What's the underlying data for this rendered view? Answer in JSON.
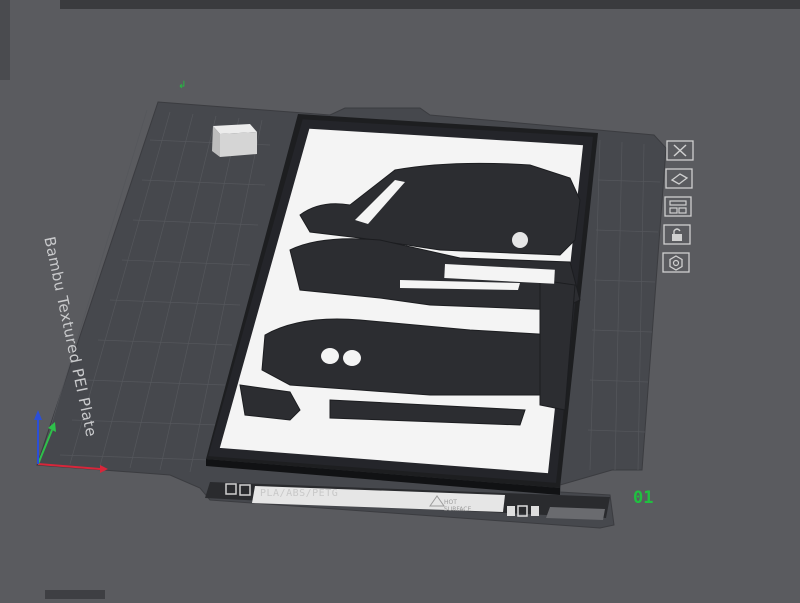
{
  "plate": {
    "name": "Bambu Textured PEI Plate",
    "filament": "PLA/ABS/PETG",
    "warning_line1": "HOT",
    "warning_line2": "SURFACE",
    "number": "01"
  },
  "toolbar": {
    "items": [
      {
        "name": "close-plate",
        "icon": "x-icon"
      },
      {
        "name": "auto-orient",
        "icon": "orient-icon"
      },
      {
        "name": "arrange",
        "icon": "arrange-icon"
      },
      {
        "name": "lock-plate",
        "icon": "lock-icon"
      },
      {
        "name": "plate-settings",
        "icon": "gear-icon"
      }
    ]
  },
  "colors": {
    "background": "#5a5b5f",
    "plate": "#45474c",
    "model": "#2a2b2e",
    "frame_border": "#1d1e20",
    "accent_green": "#20c040"
  }
}
